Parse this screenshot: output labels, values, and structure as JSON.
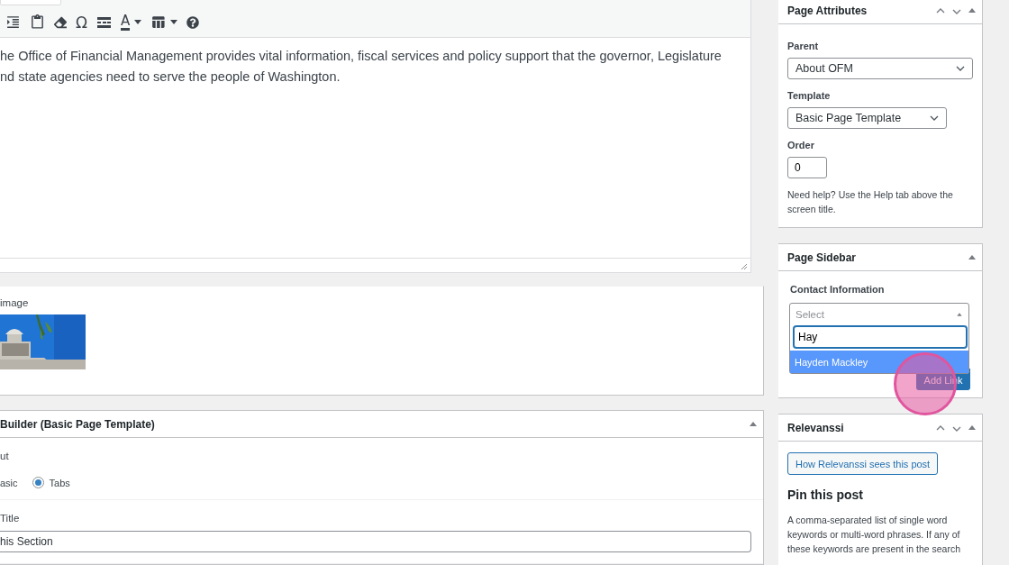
{
  "editor": {
    "toolbar_row2": [
      {
        "kind": "indent"
      },
      {
        "kind": "paste"
      },
      {
        "kind": "eraser"
      },
      {
        "kind": "char",
        "label": "Ω"
      },
      {
        "kind": "more"
      },
      {
        "kind": "color",
        "label": "A"
      },
      {
        "kind": "table"
      },
      {
        "kind": "help"
      }
    ],
    "content": "he Office of Financial Management provides vital information, fiscal services and policy support that the governor, Legislature nd state agencies need to serve the people of Washington."
  },
  "image_field": {
    "label": "image",
    "kind": "picture"
  },
  "builder": {
    "title": "Builder (Basic Page Template)",
    "layout_label": "ut",
    "cut_option_label": "asic",
    "options": [
      {
        "label": "Tabs",
        "selected": true
      }
    ],
    "title_label": "Title",
    "title_value": "his Section"
  },
  "page_attributes": {
    "title": "Page Attributes",
    "parent_label": "Parent",
    "parent_value": "About OFM",
    "template_label": "Template",
    "template_value": "Basic Page Template",
    "order_label": "Order",
    "order_value": "0",
    "help": "Need help? Use the Help tab above the screen title."
  },
  "page_sidebar": {
    "title": "Page Sidebar",
    "contact_label": "Contact Information",
    "select_placeholder": "Select",
    "search_value": "Hay",
    "options": [
      {
        "label": "Hayden Mackley",
        "selected": true
      }
    ],
    "add_button": "Add Link"
  },
  "relevanssi": {
    "title": "Relevanssi",
    "button": "How Relevanssi sees this post",
    "heading": "Pin this post",
    "text": "A comma-separated list of single word keywords or multi-word phrases. If any of these keywords are present in the search"
  }
}
